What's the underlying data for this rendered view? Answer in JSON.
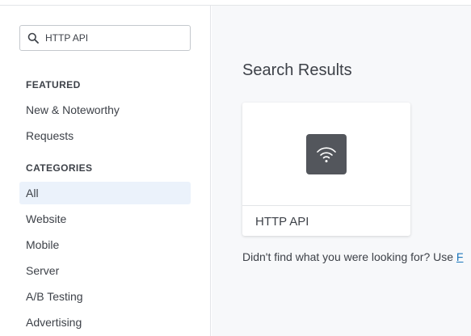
{
  "search": {
    "value": "HTTP API",
    "icon": "search-icon"
  },
  "sidebar": {
    "featured_title": "FEATURED",
    "featured": [
      "New & Noteworthy",
      "Requests"
    ],
    "categories_title": "CATEGORIES",
    "categories": [
      "All",
      "Website",
      "Mobile",
      "Server",
      "A/B Testing",
      "Advertising"
    ],
    "active_category": "All"
  },
  "main": {
    "title": "Search Results",
    "results": [
      {
        "label": "HTTP API",
        "icon": "wifi-icon"
      }
    ],
    "not_found_text": "Didn't find what you were looking for? Use ",
    "not_found_link": "F"
  },
  "colors": {
    "accent": "#1b75bb",
    "active_bg": "#ebf2fb",
    "card_icon_bg": "#53565c"
  }
}
